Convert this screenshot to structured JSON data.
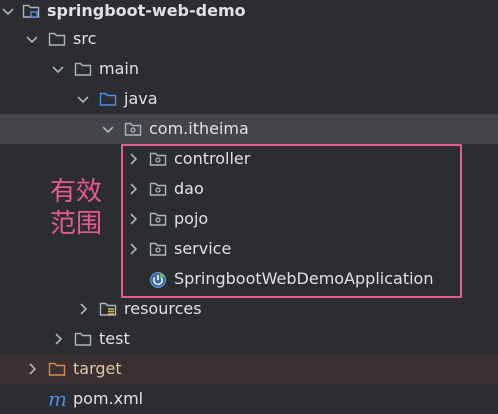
{
  "tree": {
    "root": "springboot-web-demo",
    "src": "src",
    "main": "main",
    "java": "java",
    "package": "com.itheima",
    "controller": "controller",
    "dao": "dao",
    "pojo": "pojo",
    "service": "service",
    "app_class": "SpringbootWebDemoApplication",
    "resources": "resources",
    "test": "test",
    "target": "target",
    "pom": "pom.xml"
  },
  "annotation": {
    "line1": "有效",
    "line2": "范围",
    "color": "#e55a94"
  },
  "colors": {
    "background": "#2b2d30",
    "selected_row": "#43454a",
    "folder_grey": "#aeb3bd",
    "source_folder_blue": "#4a8ee8",
    "target_folder_orange": "#d48c56",
    "spring_green": "#6cb56c"
  }
}
